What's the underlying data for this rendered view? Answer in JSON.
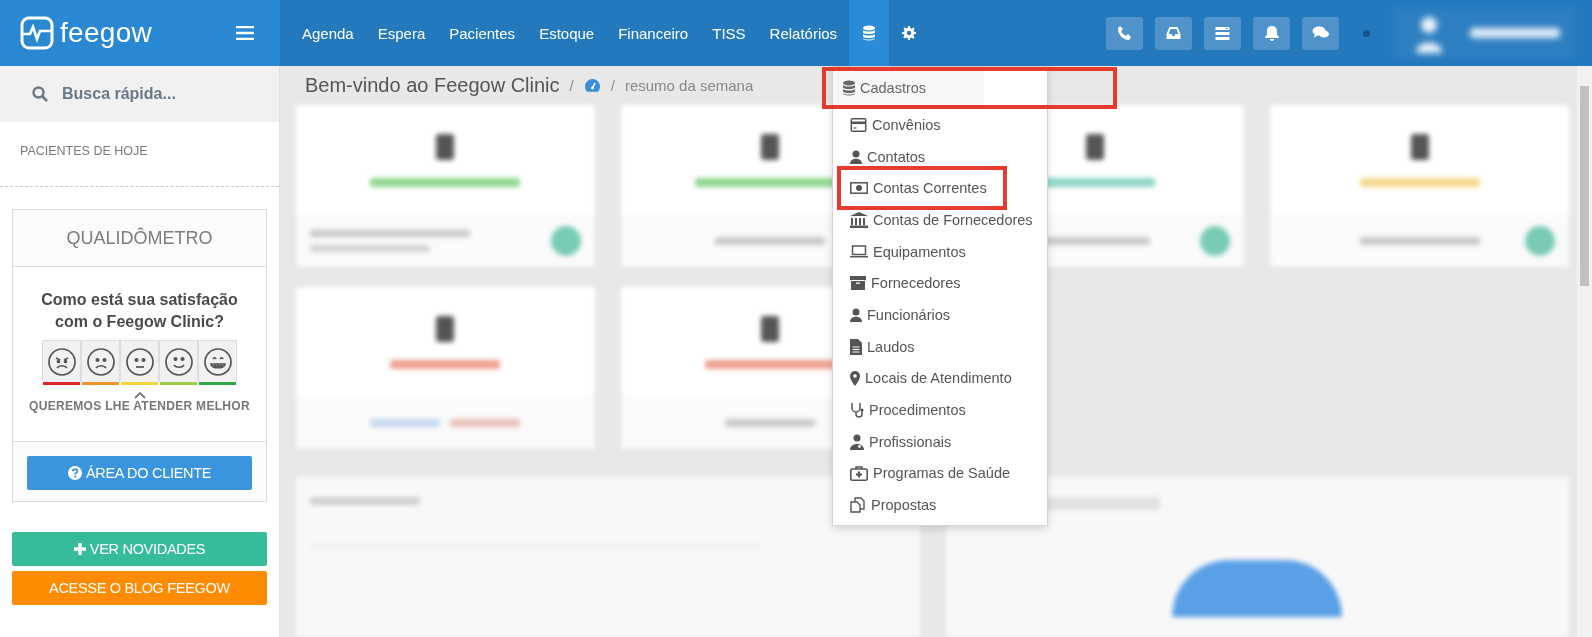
{
  "topbar": {
    "logo": "feegow",
    "nav": [
      {
        "label": "Agenda",
        "selected": false
      },
      {
        "label": "Espera",
        "selected": false
      },
      {
        "label": "Pacientes",
        "selected": false
      },
      {
        "label": "Estoque",
        "selected": false
      },
      {
        "label": "Financeiro",
        "selected": false
      },
      {
        "label": "TISS",
        "selected": false
      },
      {
        "label": "Relatórios",
        "selected": false
      }
    ],
    "icon_tabs": [
      {
        "selected": true
      },
      {
        "selected": false
      }
    ]
  },
  "sidebar": {
    "search": {
      "placeholder": "Busca rápida..."
    },
    "section_title": "PACIENTES DE HOJE",
    "qualidometro": {
      "title": "QUALIDÔMETRO",
      "question": "Como está sua satisfação com o Feegow Clinic?",
      "faces": [
        {
          "color": "#e0262b"
        },
        {
          "color": "#f0932b"
        },
        {
          "color": "#f3d43a"
        },
        {
          "color": "#9acd45"
        },
        {
          "color": "#2ea84a"
        }
      ],
      "caption": "QUEREMOS LHE ATENDER MELHOR",
      "button": "ÁREA DO CLIENTE"
    },
    "buttons": [
      {
        "label": "VER NOVIDADES",
        "kind": "news"
      },
      {
        "label": "ACESSE O BLOG FEEGOW",
        "kind": "blog"
      }
    ]
  },
  "breadcrumb": {
    "title": "Bem-vindo ao Feegow Clinic",
    "separators": [
      "/",
      "/"
    ],
    "page": "resumo da semana"
  },
  "menu": {
    "header": "Cadastros",
    "header_highlighted": true,
    "items": [
      {
        "label": "Convênios",
        "highlighted": false
      },
      {
        "label": "Contatos",
        "highlighted": false
      },
      {
        "label": "Contas Correntes",
        "highlighted": true
      },
      {
        "label": "Contas de Fornecedores",
        "highlighted": false
      },
      {
        "label": "Equipamentos",
        "highlighted": false
      },
      {
        "label": "Fornecedores",
        "highlighted": false
      },
      {
        "label": "Funcionários",
        "highlighted": false
      },
      {
        "label": "Laudos",
        "highlighted": false
      },
      {
        "label": "Locais de Atendimento",
        "highlighted": false
      },
      {
        "label": "Procedimentos",
        "highlighted": false
      },
      {
        "label": "Profissionais",
        "highlighted": false
      },
      {
        "label": "Programas de Saúde",
        "highlighted": false
      },
      {
        "label": "Propostas",
        "highlighted": false
      }
    ]
  }
}
